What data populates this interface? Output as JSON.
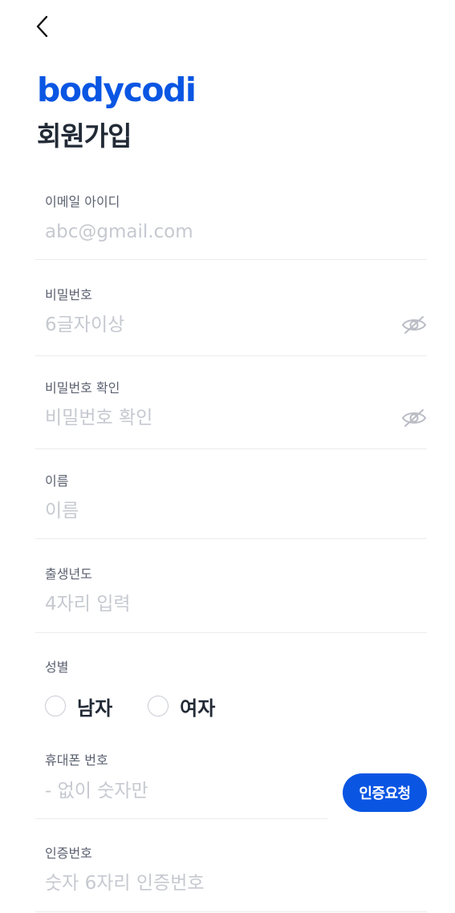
{
  "header": {
    "logo_text": "bodycodi",
    "title": "회원가입",
    "back_icon": "chevron-left-icon"
  },
  "form": {
    "email": {
      "label": "이메일 아이디",
      "placeholder": "abc@gmail.com",
      "value": ""
    },
    "password": {
      "label": "비밀번호",
      "placeholder": "6글자이상",
      "value": "",
      "toggle_icon": "eye-off-icon"
    },
    "password_confirm": {
      "label": "비밀번호 확인",
      "placeholder": "비밀번호 확인",
      "value": "",
      "toggle_icon": "eye-off-icon"
    },
    "name": {
      "label": "이름",
      "placeholder": "이름",
      "value": ""
    },
    "birth_year": {
      "label": "출생년도",
      "placeholder": "4자리 입력",
      "value": ""
    },
    "gender": {
      "label": "성별",
      "options": [
        {
          "label": "남자",
          "selected": false
        },
        {
          "label": "여자",
          "selected": false
        }
      ]
    },
    "phone": {
      "label": "휴대폰 번호",
      "placeholder": "- 없이 숫자만",
      "value": "",
      "verify_button": "인증요청"
    },
    "verification_code": {
      "label": "인증번호",
      "placeholder": "숫자 6자리 인증번호",
      "value": ""
    }
  },
  "colors": {
    "brand": "#0a56e3",
    "text": "#222a36",
    "label": "#5b6170",
    "placeholder": "#c6c9d0",
    "divider": "#ececef"
  }
}
